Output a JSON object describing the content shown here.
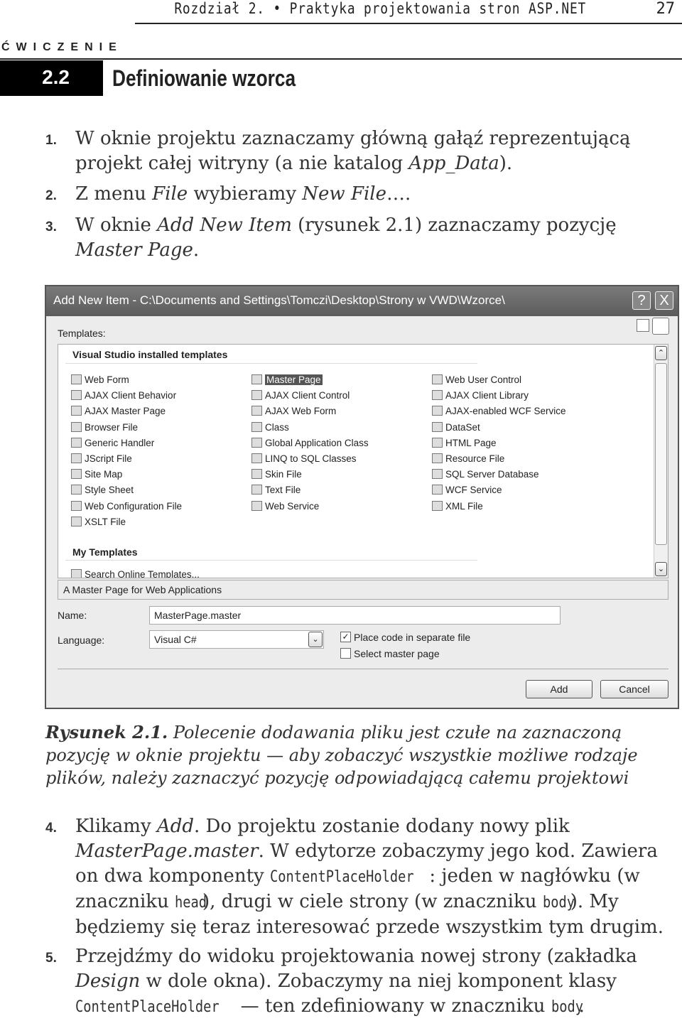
{
  "header": {
    "running_title": "Rozdział 2. • Praktyka projektowania stron ASP.NET",
    "page_number": "27"
  },
  "exercise": {
    "label": "ĆWICZENIE",
    "number": "2.2",
    "title": "Definiowanie wzorca"
  },
  "steps_a": [
    {
      "n": "1.",
      "parts": [
        "W oknie projektu zaznaczamy główną gałąź reprezentującą projekt całej witryny (a nie katalog ",
        "App_Data",
        "). "
      ]
    },
    {
      "n": "2.",
      "parts": [
        "Z menu ",
        "File",
        " wybieramy ",
        "New File",
        "…."
      ]
    },
    {
      "n": "3.",
      "parts": [
        "W oknie ",
        "Add New Item",
        " (rysunek 2.1) zaznaczamy pozycję ",
        "Master Page",
        "."
      ]
    }
  ],
  "dialog": {
    "title": "Add New Item - C:\\Documents and Settings\\Tomczi\\Desktop\\Strony w VWD\\Wzorce\\",
    "help": "?",
    "close": "X",
    "templates_label": "Templates:",
    "group1": "Visual Studio installed templates",
    "columns": [
      [
        "Web Form",
        "AJAX Client Behavior",
        "AJAX Master Page",
        "Browser File",
        "Generic Handler",
        "JScript File",
        "Site Map",
        "Style Sheet",
        "Web Configuration File",
        "XSLT File"
      ],
      [
        "Master Page",
        "AJAX Client Control",
        "AJAX Web Form",
        "Class",
        "Global Application Class",
        "LINQ to SQL Classes",
        "Skin File",
        "Text File",
        "Web Service"
      ],
      [
        "Web User Control",
        "AJAX Client Library",
        "AJAX-enabled WCF Service",
        "DataSet",
        "HTML Page",
        "Resource File",
        "SQL Server Database",
        "WCF Service",
        "XML File"
      ]
    ],
    "selected": "Master Page",
    "group2": "My Templates",
    "group2_item": "Search Online Templates...",
    "description": "A Master Page for Web Applications",
    "name_label": "Name:",
    "name_value": "MasterPage.master",
    "language_label": "Language:",
    "language_value": "Visual C#",
    "checkbox1": {
      "label": "Place code in separate file",
      "checked": true
    },
    "checkbox2": {
      "label": "Select master page",
      "checked": false
    },
    "add": "Add",
    "cancel": "Cancel"
  },
  "caption": {
    "label": "Rysunek 2.1.",
    "text": " Polecenie dodawania pliku jest czułe na zaznaczoną pozycję w oknie projektu — aby zobaczyć wszystkie możliwe rodzaje plików, należy zaznaczyć pozycję odpowiadającą całemu projektowi"
  },
  "steps_b": [
    {
      "n": "4.",
      "parts": [
        [
          "t",
          "Klikamy "
        ],
        [
          "i",
          "Add"
        ],
        [
          "t",
          ". Do projektu zostanie dodany nowy plik "
        ],
        [
          "i",
          "MasterPage.master"
        ],
        [
          "t",
          ". W edytorze zobaczymy jego kod. Zawiera on dwa komponenty "
        ],
        [
          "m",
          "ContentPlaceHolder"
        ],
        [
          "t",
          ": jeden w nagłówku (w znaczniku "
        ],
        [
          "m",
          "head"
        ],
        [
          "t",
          "), drugi w ciele strony (w znaczniku "
        ],
        [
          "m",
          "body"
        ],
        [
          "t",
          "). My będziemy się teraz interesować przede wszystkim tym drugim."
        ]
      ]
    },
    {
      "n": "5.",
      "parts": [
        [
          "t",
          "Przejdźmy do widoku projektowania nowej strony (zakładka "
        ],
        [
          "i",
          "Design"
        ],
        [
          "t",
          " w dole okna). Zobaczymy na niej komponent klasy "
        ],
        [
          "m",
          "ContentPlaceHolder"
        ],
        [
          "t",
          " — ten zdefiniowany w znaczniku "
        ],
        [
          "m",
          "body"
        ],
        [
          "t",
          "."
        ]
      ]
    }
  ]
}
